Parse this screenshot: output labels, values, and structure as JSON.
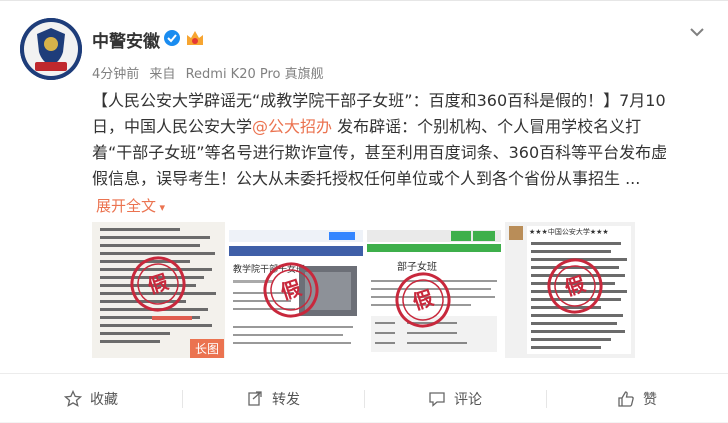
{
  "user": {
    "name": "中警安徽",
    "avatar_text": "中国警察网 安徽"
  },
  "meta": {
    "time": "4分钟前",
    "source_prefix": "来自",
    "source": "Redmi K20 Pro 真旗舰"
  },
  "post": {
    "line1_a": "【人民公安大学辟谣无“成教学院干部子女班”：百度和360百科是假的！】7月10",
    "line2_a": "日，中国人民公安大学",
    "mention": "@公大招办",
    "line2_b": " 发布辟谣：个别机构、个人冒用学校名义打",
    "line3": "着“干部子女班”等名号进行欺诈宣传，甚至利用百度词条、360百科等平台发布虚",
    "line4": "假信息，误导考生！公大从未委托授权任何单位或个人到各个省份从事招生 ...",
    "expand_label": "展开全文"
  },
  "images": {
    "stamp_text": "假",
    "long_tag": "长图",
    "img1_title": "中国公安大学",
    "img2_title": "教学院干部子女班",
    "img3_title": "部子女班",
    "img4_title": "★★★中国公安大学★★★"
  },
  "actions": {
    "favorite": "收藏",
    "repost": "转发",
    "comment": "评论",
    "like": "赞"
  },
  "colors": {
    "accent": "#eb7350",
    "verified": "#1a8cf0",
    "stamp": "#c8283c"
  }
}
